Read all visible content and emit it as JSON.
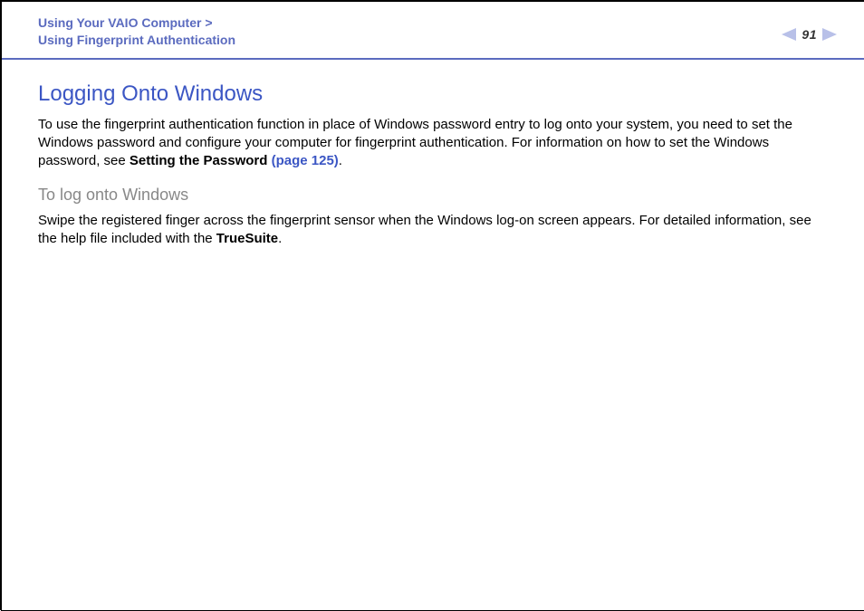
{
  "header": {
    "breadcrumb_line1": "Using Your VAIO Computer >",
    "breadcrumb_line2": "Using Fingerprint Authentication",
    "page_number": "91"
  },
  "main": {
    "title": "Logging Onto Windows",
    "intro_part1": "To use the fingerprint authentication function in place of Windows password entry to log onto your system, you need to set the Windows password and configure your computer for fingerprint authentication. For information on how to set the Windows password, see ",
    "intro_bold": "Setting the Password ",
    "intro_link": "(page 125)",
    "intro_part2": ".",
    "subhead": "To log onto Windows",
    "sub_body_part1": "Swipe the registered finger across the fingerprint sensor when the Windows log-on screen appears. For detailed information, see the help file included with the ",
    "sub_body_bold": "TrueSuite",
    "sub_body_part2": "."
  }
}
